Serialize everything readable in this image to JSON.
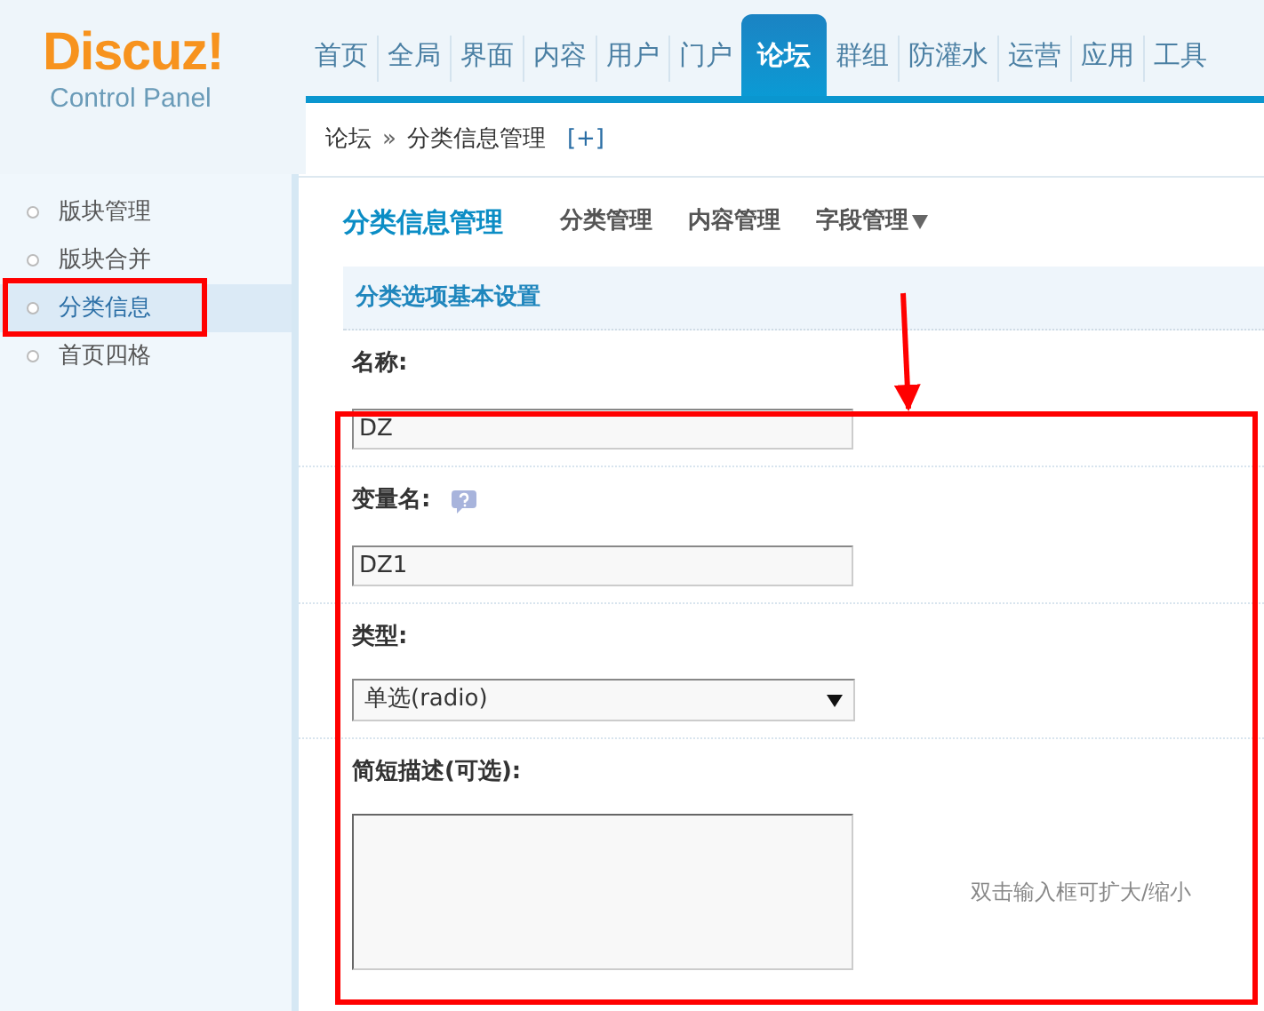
{
  "logo": {
    "name": "Discuz!",
    "subtitle": "Control Panel"
  },
  "nav": [
    {
      "label": "首页",
      "selected": false
    },
    {
      "label": "全局",
      "selected": false
    },
    {
      "label": "界面",
      "selected": false
    },
    {
      "label": "内容",
      "selected": false
    },
    {
      "label": "用户",
      "selected": false
    },
    {
      "label": "门户",
      "selected": false
    },
    {
      "label": "论坛",
      "selected": true
    },
    {
      "label": "群组",
      "selected": false
    },
    {
      "label": "防灌水",
      "selected": false
    },
    {
      "label": "运营",
      "selected": false
    },
    {
      "label": "应用",
      "selected": false
    },
    {
      "label": "工具",
      "selected": false
    }
  ],
  "breadcrumb": {
    "items": [
      "论坛",
      "分类信息管理"
    ],
    "separator": "»",
    "add": "[+]"
  },
  "sidebar": {
    "items": [
      {
        "label": "版块管理",
        "selected": false
      },
      {
        "label": "版块合并",
        "selected": false
      },
      {
        "label": "分类信息",
        "selected": true
      },
      {
        "label": "首页四格",
        "selected": false
      }
    ]
  },
  "page_title": "分类信息管理",
  "subnav": [
    {
      "label": "分类管理",
      "has_menu": false
    },
    {
      "label": "内容管理",
      "has_menu": false
    },
    {
      "label": "字段管理",
      "has_menu": true
    }
  ],
  "section_title": "分类选项基本设置",
  "fields": [
    {
      "kind": "text",
      "label": "名称:",
      "value": "DZ"
    },
    {
      "kind": "text",
      "label": "变量名:",
      "help": true,
      "value": "DZ1"
    },
    {
      "kind": "select",
      "label": "类型:",
      "value": "单选(radio)"
    },
    {
      "kind": "textarea",
      "label": "简短描述(可选):",
      "hint": "双击输入框可扩大/缩小"
    }
  ]
}
